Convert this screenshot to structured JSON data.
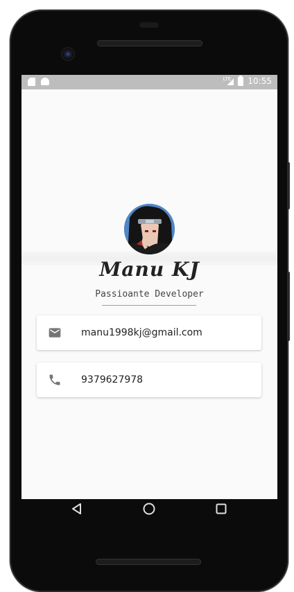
{
  "status_bar": {
    "time": "10:55",
    "network": "LTE",
    "icons": [
      "sim-card-icon",
      "android-icon",
      "signal-icon",
      "battery-icon"
    ]
  },
  "profile": {
    "name": "Manu KJ",
    "tagline": "Passioante Developer"
  },
  "contacts": [
    {
      "icon": "email-icon",
      "value": "manu1998kj@gmail.com"
    },
    {
      "icon": "phone-icon",
      "value": "9379627978"
    }
  ],
  "nav_bar": {
    "buttons": [
      "back-icon",
      "home-icon",
      "recents-icon"
    ]
  },
  "colors": {
    "status_bar": "#bdbdbd",
    "screen_bg": "#fafafa",
    "card_bg": "#ffffff",
    "icon": "#757575"
  }
}
